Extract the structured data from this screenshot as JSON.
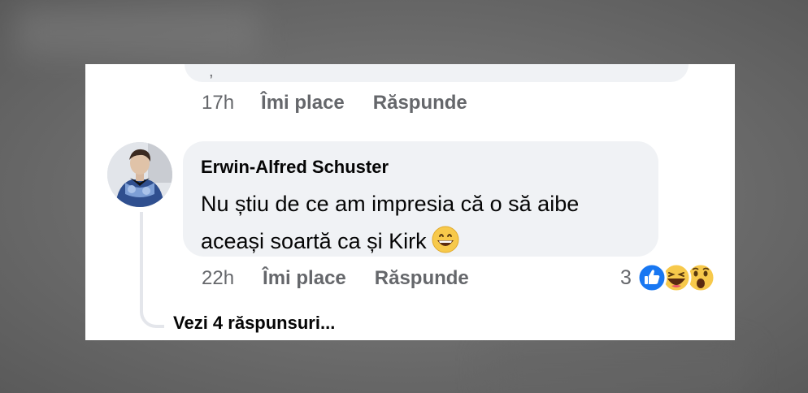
{
  "previous_comment": {
    "visible_text": ",",
    "time": "17h",
    "like_label": "Îmi place",
    "reply_label": "Răspunde"
  },
  "comment": {
    "author": "Erwin-Alfred Schuster",
    "text": "Nu știu de ce am impresia că o să aibe aceași soartă ca și Kirk",
    "emoji": "grinning-face",
    "time": "22h",
    "like_label": "Îmi place",
    "reply_label": "Răspunde",
    "reaction_count": "3",
    "reaction_icons": [
      "like-reaction",
      "haha-reaction",
      "wow-reaction"
    ]
  },
  "replies": {
    "view_label": "Vezi 4 răspunsuri..."
  },
  "colors": {
    "meta_text": "#65676b",
    "bubble_bg": "#f0f2f5",
    "like_blue": "#1877f2",
    "reaction_yellow": "#f7c94b"
  }
}
